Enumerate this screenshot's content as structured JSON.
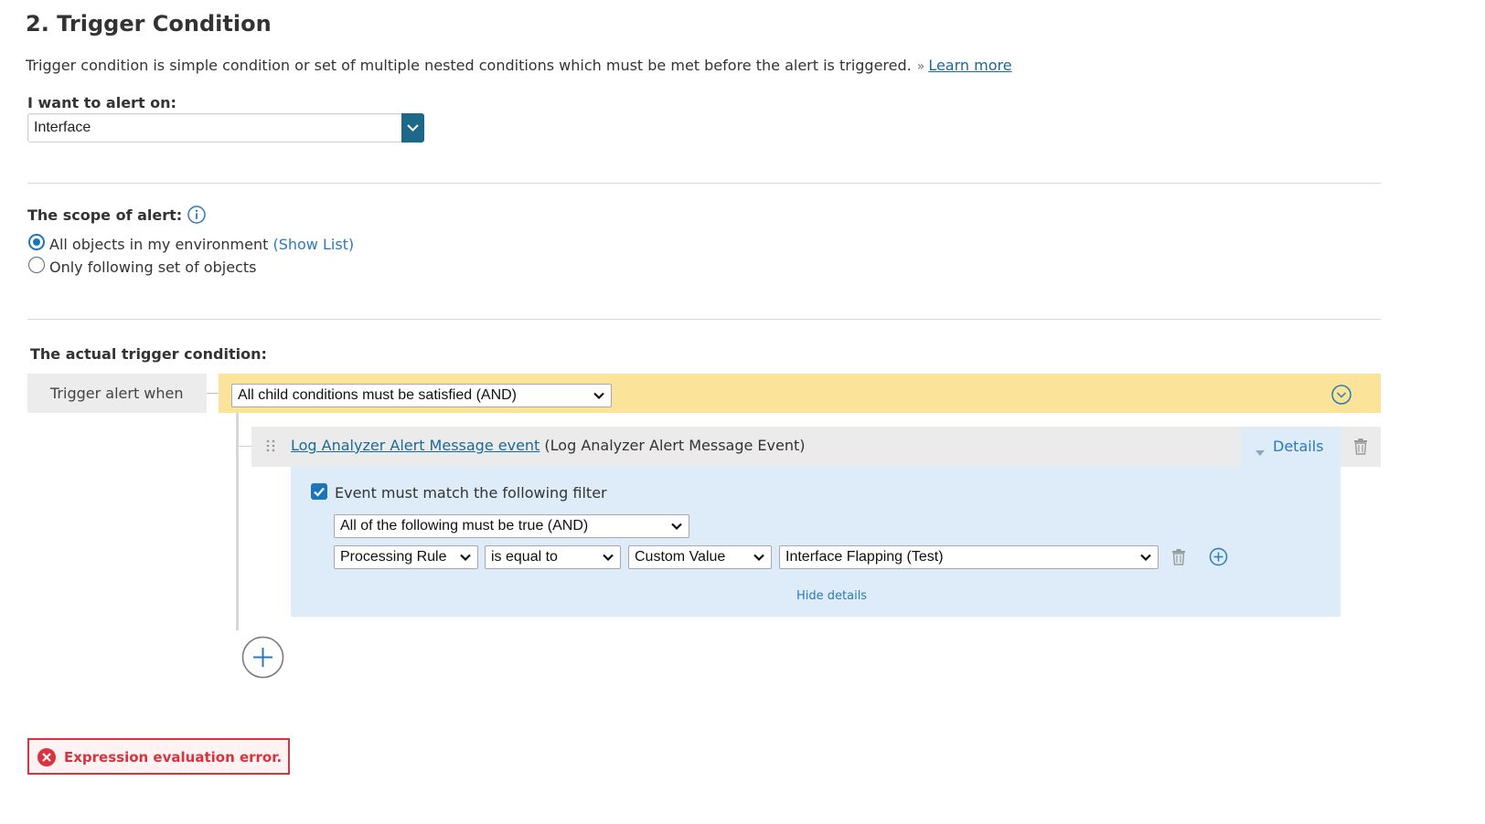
{
  "section": {
    "title": "2. Trigger Condition",
    "description": "Trigger condition is simple condition or set of multiple nested conditions which must be met before the alert is triggered.",
    "learn_more_prefix": "»",
    "learn_more": "Learn more"
  },
  "alert_on": {
    "label": "I want to alert on:",
    "value": "Interface"
  },
  "scope": {
    "label": "The scope of alert:",
    "option_all": "All objects in my environment",
    "show_list": "(Show List)",
    "option_following": "Only following set of objects",
    "selected": "all"
  },
  "trigger": {
    "label": "The actual trigger condition:",
    "trigger_when": "Trigger alert when",
    "condition_select": "All child conditions must be satisfied (AND)",
    "event": {
      "link": "Log Analyzer Alert Message event",
      "suffix": "(Log Analyzer Alert Message Event)",
      "details_label": "Details",
      "filter_checkbox_label": "Event must match the following filter",
      "filter_checked": true,
      "filter_logic": "All of the following must be true (AND)",
      "rule": {
        "field": "Processing Rule",
        "operator": "is equal to",
        "value_type": "Custom Value",
        "value": "Interface Flapping (Test)"
      },
      "hide_details": "Hide details"
    }
  },
  "error": {
    "message": "Expression evaluation error."
  },
  "colors": {
    "accent": "#1b6888",
    "link": "#1a6a96",
    "highlight": "#fbe39a",
    "panel": "#deebf9",
    "error": "#d9333f"
  }
}
